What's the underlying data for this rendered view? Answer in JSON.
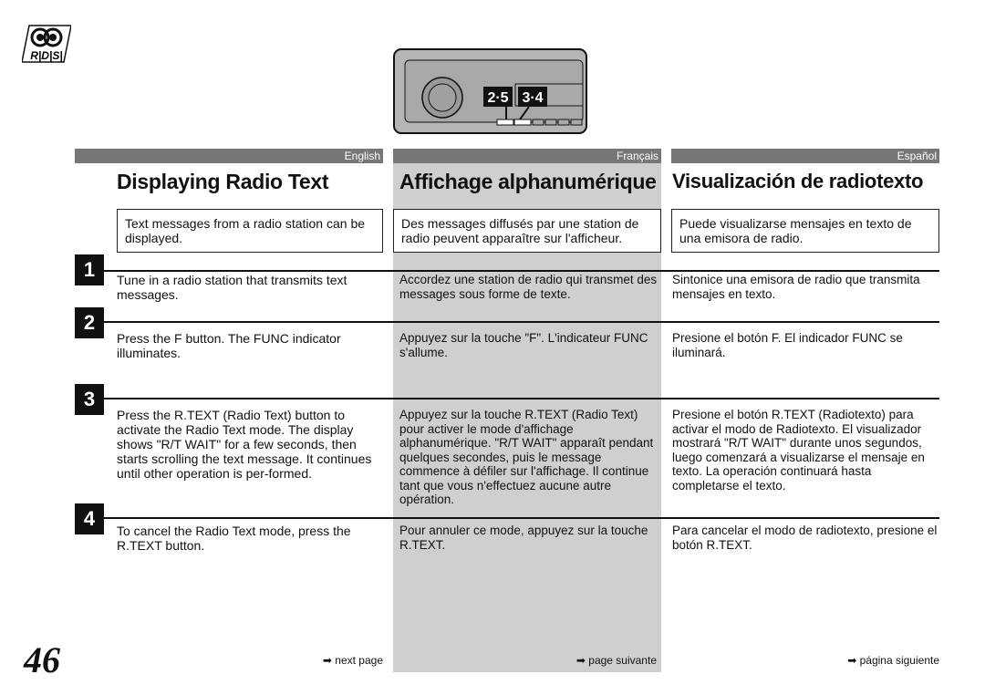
{
  "page_number": "46",
  "logo_text": "RDS",
  "device_labels": [
    "2·5",
    "3·4"
  ],
  "step_numbers": [
    "1",
    "2",
    "3",
    "4"
  ],
  "columns": {
    "en": {
      "lang": "English",
      "title": "Displaying Radio Text",
      "intro": "Text messages from a radio station can be displayed.",
      "steps": [
        "Tune in a radio station that transmits text messages.",
        "Press the F button. The FUNC indicator illuminates.",
        "Press the R.TEXT (Radio Text) button to activate the Radio Text mode. The display shows \"R/T WAIT\" for a few seconds, then starts scrolling the text message. It continues until other operation is per-formed.",
        "To cancel the Radio Text mode, press the R.TEXT button."
      ],
      "next": "next page"
    },
    "fr": {
      "lang": "Français",
      "title": "Affichage alphanumérique",
      "intro": "Des messages diffusés par une station de radio peuvent apparaître sur l'afficheur.",
      "steps": [
        "Accordez une station de radio qui transmet des messages sous forme de texte.",
        "Appuyez sur la touche \"F\". L'indicateur FUNC s'allume.",
        "Appuyez sur la touche R.TEXT (Radio Text) pour activer le mode d'affichage alphanumérique. \"R/T WAIT\" apparaît pendant quelques secondes, puis le message commence à défiler sur l'affichage. Il continue tant que vous n'effectuez aucune autre opération.",
        "Pour annuler ce mode, appuyez sur la touche R.TEXT."
      ],
      "next": "page suivante"
    },
    "es": {
      "lang": "Español",
      "title": "Visualización de radiotexto",
      "intro": "Puede visualizarse mensajes en texto de una emisora de radio.",
      "steps": [
        "Sintonice una emisora de radio que transmita mensajes en texto.",
        "Presione el botón F. El indicador FUNC se iluminará.",
        "Presione el botón R.TEXT (Radiotexto) para activar el modo de Radiotexto. El visualizador mostrará \"R/T WAIT\" durante unos segundos, luego comenzará a visualizarse el mensaje en texto. La operación continuará hasta completarse el texto.",
        "Para cancelar el modo de radiotexto, presione el botón R.TEXT."
      ],
      "next": "página siguiente"
    }
  },
  "colors": {
    "lang_bar": "#777777",
    "french_column_bg": "#cfcfcf"
  }
}
